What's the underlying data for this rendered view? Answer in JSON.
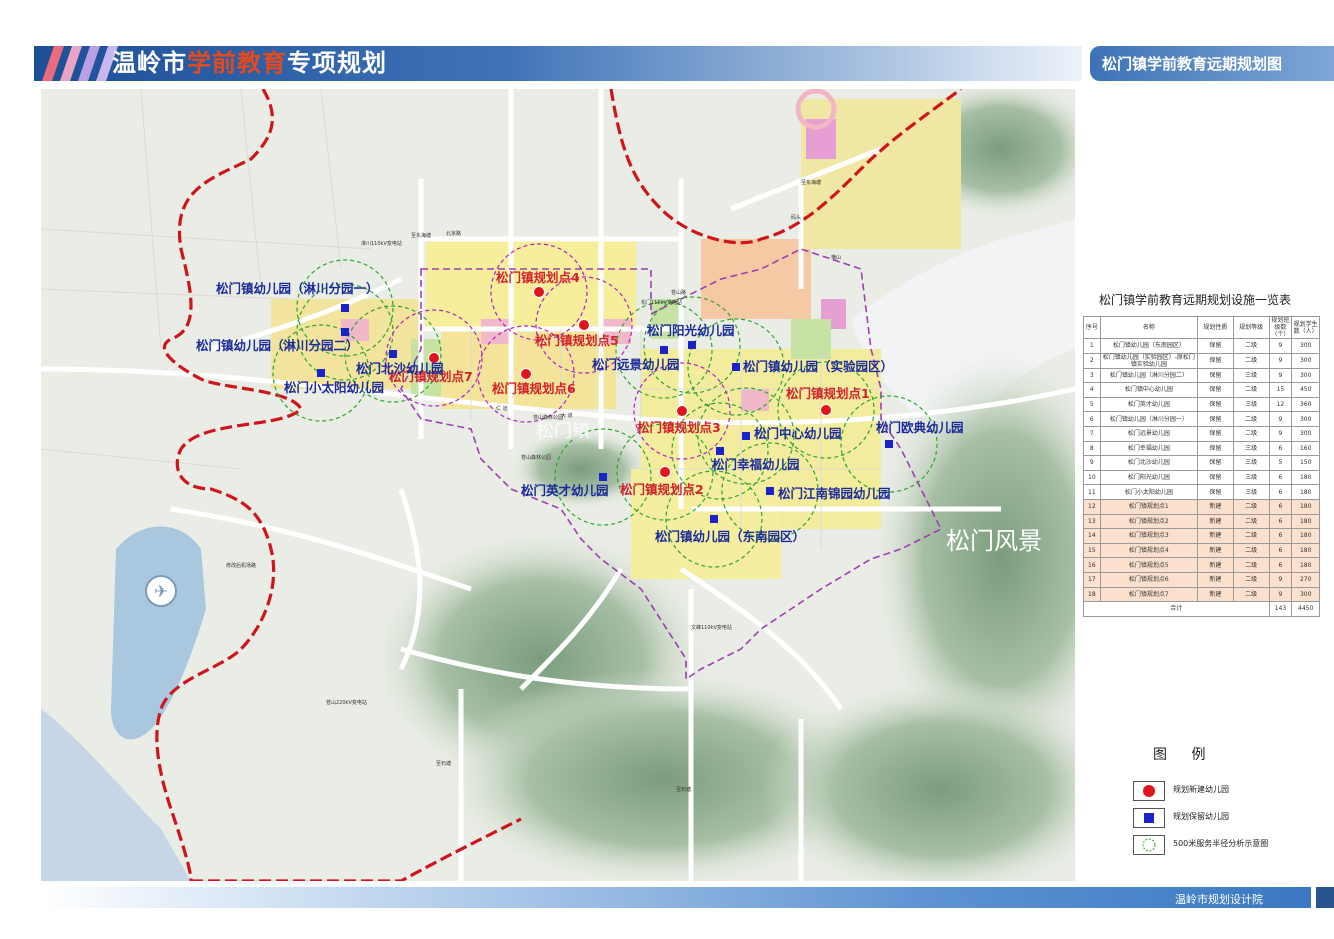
{
  "header": {
    "title_part1": "温岭市",
    "title_part2": "学前教育",
    "title_part3": "专项规划",
    "map_title": "松门镇学前教育远期规划图"
  },
  "map": {
    "scenic_label": "松门风景",
    "scenic_label_faint": "松门镇",
    "kindergartens_new": [
      {
        "label": "松门镇规划点1"
      },
      {
        "label": "松门镇规划点2"
      },
      {
        "label": "松门镇规划点3"
      },
      {
        "label": "松门镇规划点4"
      },
      {
        "label": "松门镇规划点5"
      },
      {
        "label": "松门镇规划点6"
      },
      {
        "label": "松门镇规划点7"
      }
    ],
    "kindergartens_kept": [
      {
        "label": "松门镇幼儿园（淋川分园一）"
      },
      {
        "label": "松门镇幼儿园（淋川分园二）"
      },
      {
        "label": "松门小太阳幼儿园"
      },
      {
        "label": "松门北沙幼儿园"
      },
      {
        "label": "松门阳光幼儿园"
      },
      {
        "label": "松门远景幼儿园"
      },
      {
        "label": "松门镇幼儿园（实验园区）"
      },
      {
        "label": "松门中心幼儿园"
      },
      {
        "label": "松门幸福幼儿园"
      },
      {
        "label": "松门欧典幼儿园"
      },
      {
        "label": "松门英才幼儿园"
      },
      {
        "label": "松门江南锦园幼儿园"
      },
      {
        "label": "松门镇幼儿园（东南园区）"
      }
    ],
    "road_labels": [
      "北京路",
      "仁 道",
      "苍山森林公园",
      "苍山森林公园",
      "修改后机场路",
      "淋川110kV变电站",
      "松门110kV变电站",
      "文峰110kV变电站",
      "苍山220kV变电站",
      "至东海塘",
      "至东海塘",
      "至石塘",
      "至石塘",
      "码头",
      "横山",
      "大 道",
      "苍山路"
    ]
  },
  "table": {
    "title": "松门镇学前教育远期规划设施一览表",
    "headers": [
      "序号",
      "名称",
      "规划性质",
      "规划等级",
      "规划班级数（个）",
      "规划学生数（人）"
    ],
    "rows": [
      [
        "1",
        "松门镇幼儿园（东南园区）",
        "保留",
        "二级",
        "9",
        "300"
      ],
      [
        "2",
        "松门镇幼儿园（实验园区）-原松门镇实验幼儿园",
        "保留",
        "二级",
        "9",
        "300"
      ],
      [
        "3",
        "松门镇幼儿园（淋川分园二）",
        "保留",
        "三级",
        "9",
        "300"
      ],
      [
        "4",
        "松门镇中心幼儿园",
        "保留",
        "二级",
        "15",
        "450"
      ],
      [
        "5",
        "松门英才幼儿园",
        "保留",
        "三级",
        "12",
        "360"
      ],
      [
        "6",
        "松门镇幼儿园（淋川分园一）",
        "保留",
        "二级",
        "9",
        "300"
      ],
      [
        "7",
        "松门远景幼儿园",
        "保留",
        "二级",
        "9",
        "300"
      ],
      [
        "8",
        "松门幸福幼儿园",
        "保留",
        "三级",
        "6",
        "160"
      ],
      [
        "9",
        "松门北沙幼儿园",
        "保留",
        "三级",
        "5",
        "150"
      ],
      [
        "10",
        "松门阳光幼儿园",
        "保留",
        "三级",
        "6",
        "180"
      ],
      [
        "11",
        "松门小太阳幼儿园",
        "保留",
        "三级",
        "6",
        "180"
      ],
      [
        "12",
        "松门镇规划点1",
        "新建",
        "二级",
        "6",
        "180"
      ],
      [
        "13",
        "松门镇规划点2",
        "新建",
        "二级",
        "6",
        "180"
      ],
      [
        "14",
        "松门镇规划点3",
        "新建",
        "二级",
        "6",
        "180"
      ],
      [
        "15",
        "松门镇规划点4",
        "新建",
        "二级",
        "6",
        "180"
      ],
      [
        "16",
        "松门镇规划点5",
        "新建",
        "二级",
        "6",
        "180"
      ],
      [
        "17",
        "松门镇规划点6",
        "新建",
        "二级",
        "9",
        "270"
      ],
      [
        "18",
        "松门镇规划点7",
        "新建",
        "二级",
        "9",
        "300"
      ]
    ],
    "total": {
      "label": "合计",
      "classes": "143",
      "students": "4450"
    }
  },
  "legend": {
    "title": "图 例",
    "items": [
      {
        "label": "规划新建幼儿园",
        "color": "#e0141c",
        "icon": "red-circle-icon"
      },
      {
        "label": "规划保留幼儿园",
        "color": "#1a23c8",
        "icon": "blue-square-icon"
      },
      {
        "label": "500米服务半径分析示意圈",
        "color": "#2da52d",
        "icon": "dashed-circle-icon"
      }
    ]
  },
  "footer": {
    "text": "温岭市规划设计院"
  },
  "colors": {
    "new_kindergarten": "#e0141c",
    "kept_kindergarten": "#1a23c8",
    "service_radius": "#2da52d",
    "planning_boundary": "#d0141c",
    "urban_area": "#9b3fb3"
  }
}
